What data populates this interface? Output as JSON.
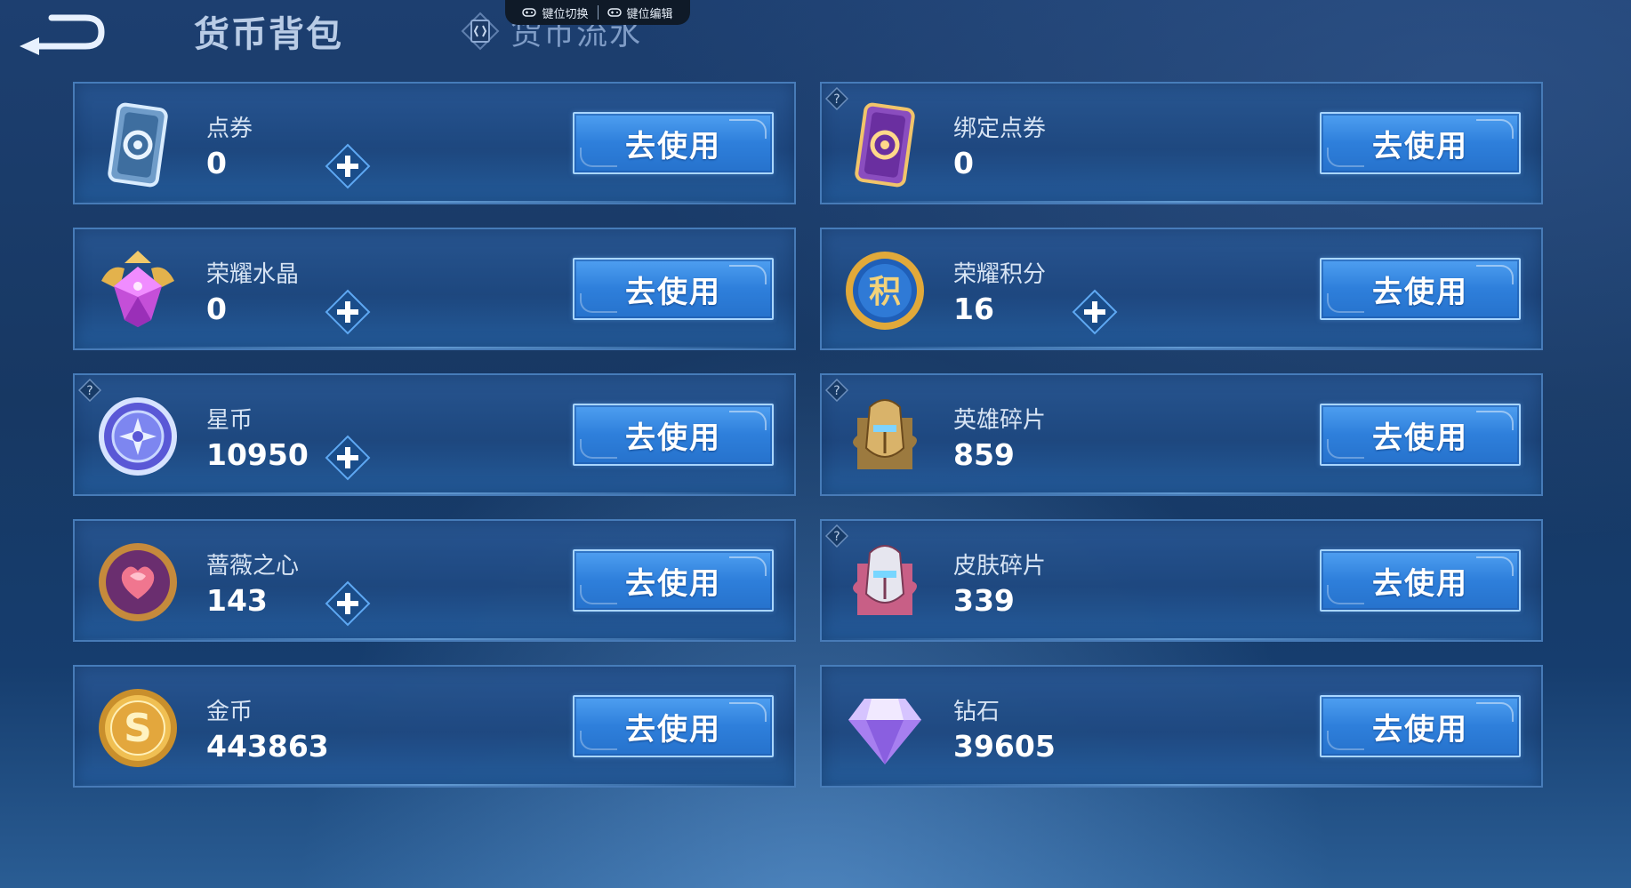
{
  "header": {
    "title": "货币背包",
    "flow_tab_label": "货币流水",
    "back_icon": "back-arrow-icon"
  },
  "overlay": {
    "switch_label": "键位切换",
    "edit_label": "键位编辑"
  },
  "currencies": [
    {
      "name": "点券",
      "value": "0",
      "icon": "coupon-card-icon",
      "has_plus": true,
      "has_help": false,
      "button": "去使用"
    },
    {
      "name": "绑定点券",
      "value": "0",
      "icon": "bound-coupon-card-icon",
      "has_plus": false,
      "has_help": true,
      "button": "去使用"
    },
    {
      "name": "荣耀水晶",
      "value": "0",
      "icon": "glory-crystal-icon",
      "has_plus": true,
      "has_help": false,
      "button": "去使用"
    },
    {
      "name": "荣耀积分",
      "value": "16",
      "icon": "glory-points-icon",
      "has_plus": true,
      "has_help": false,
      "button": "去使用"
    },
    {
      "name": "星币",
      "value": "10950",
      "icon": "star-coin-icon",
      "has_plus": true,
      "has_help": true,
      "button": "去使用"
    },
    {
      "name": "英雄碎片",
      "value": "859",
      "icon": "hero-fragment-icon",
      "has_plus": false,
      "has_help": true,
      "button": "去使用"
    },
    {
      "name": "蔷薇之心",
      "value": "143",
      "icon": "rose-heart-icon",
      "has_plus": true,
      "has_help": false,
      "button": "去使用"
    },
    {
      "name": "皮肤碎片",
      "value": "339",
      "icon": "skin-fragment-icon",
      "has_plus": false,
      "has_help": true,
      "button": "去使用"
    },
    {
      "name": "金币",
      "value": "443863",
      "icon": "gold-coin-icon",
      "has_plus": false,
      "has_help": false,
      "button": "去使用"
    },
    {
      "name": "钻石",
      "value": "39605",
      "icon": "diamond-icon",
      "has_plus": false,
      "has_help": false,
      "button": "去使用"
    }
  ],
  "colors": {
    "background": "#173863",
    "card": "#1e4880",
    "button": "#2e7fdb",
    "title": "#b9cce6"
  }
}
